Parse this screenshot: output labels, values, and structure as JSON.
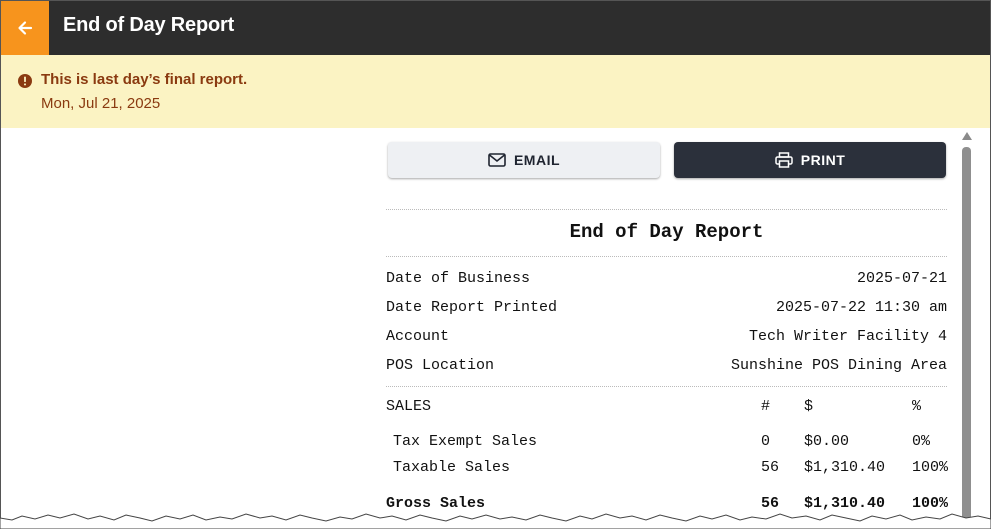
{
  "header": {
    "title": "End of Day Report"
  },
  "banner": {
    "message": "This is last day’s final report.",
    "date": "Mon, Jul 21, 2025"
  },
  "actions": {
    "email_label": "EMAIL",
    "print_label": "PRINT"
  },
  "report": {
    "title": "End of Day Report",
    "info": [
      {
        "label": "Date of Business",
        "value": "2025-07-21"
      },
      {
        "label": "Date Report Printed",
        "value": "2025-07-22 11:30 am"
      },
      {
        "label": "Account",
        "value": "Tech Writer Facility 4"
      },
      {
        "label": "POS Location",
        "value": "Sunshine POS Dining Area"
      }
    ],
    "sales": {
      "header": {
        "label": "SALES",
        "count": "#",
        "amount": "$",
        "percent": "%"
      },
      "rows": [
        {
          "label": "Tax Exempt Sales",
          "count": "0",
          "amount": "$0.00",
          "percent": "0%"
        },
        {
          "label": "Taxable Sales",
          "count": "56",
          "amount": "$1,310.40",
          "percent": "100%"
        }
      ],
      "total": {
        "label": "Gross Sales",
        "count": "56",
        "amount": "$1,310.40",
        "percent": "100%"
      }
    }
  }
}
